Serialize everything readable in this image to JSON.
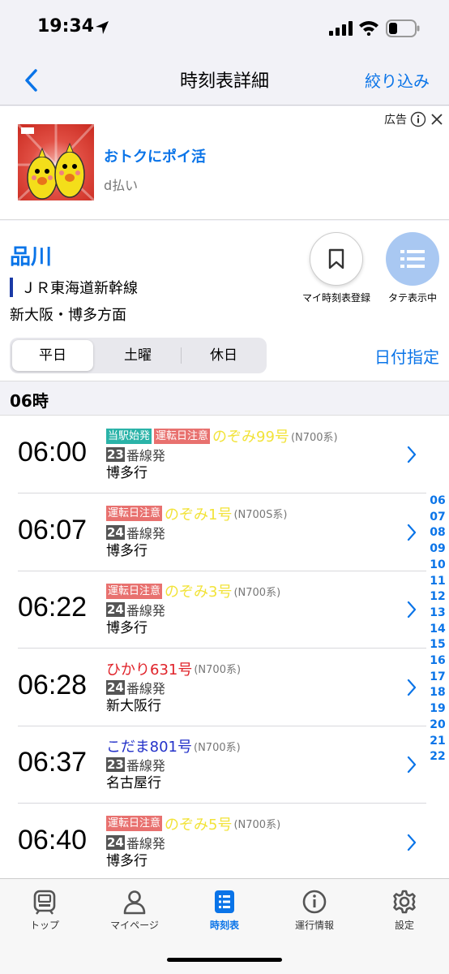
{
  "status_bar": {
    "time": "19:34"
  },
  "nav": {
    "title": "時刻表詳細",
    "filter_label": "絞り込み"
  },
  "ad": {
    "label": "広告",
    "title": "おトクにポイ活",
    "sponsor": "d払い"
  },
  "station": {
    "name": "品川",
    "line": "ＪＲ東海道新幹線",
    "line_color": "#1a3aa6",
    "direction": "新大阪・博多方面",
    "my_timetable_label": "マイ時刻表登録",
    "vertical_view_label": "タテ表示中"
  },
  "day_tabs": {
    "items": [
      "平日",
      "土曜",
      "休日"
    ],
    "selected": "平日",
    "date_label": "日付指定"
  },
  "hour_header": "06時",
  "departures": [
    {
      "time": "06:00",
      "badges": [
        "当駅始発",
        "運転日注意"
      ],
      "train": "のぞみ99号",
      "train_color": "yellow",
      "car": "(N700系)",
      "platform": "23",
      "platform_suffix": "番線発",
      "destination": "博多行"
    },
    {
      "time": "06:07",
      "badges": [
        "運転日注意"
      ],
      "train": "のぞみ1号",
      "train_color": "yellow",
      "car": "(N700S系)",
      "platform": "24",
      "platform_suffix": "番線発",
      "destination": "博多行"
    },
    {
      "time": "06:22",
      "badges": [
        "運転日注意"
      ],
      "train": "のぞみ3号",
      "train_color": "yellow",
      "car": "(N700系)",
      "platform": "24",
      "platform_suffix": "番線発",
      "destination": "博多行"
    },
    {
      "time": "06:28",
      "badges": [],
      "train": "ひかり631号",
      "train_color": "red",
      "car": "(N700系)",
      "platform": "24",
      "platform_suffix": "番線発",
      "destination": "新大阪行"
    },
    {
      "time": "06:37",
      "badges": [],
      "train": "こだま801号",
      "train_color": "blue",
      "car": "(N700系)",
      "platform": "23",
      "platform_suffix": "番線発",
      "destination": "名古屋行"
    },
    {
      "time": "06:40",
      "badges": [
        "運転日注意"
      ],
      "train": "のぞみ5号",
      "train_color": "yellow",
      "car": "(N700系)",
      "platform": "24",
      "platform_suffix": "番線発",
      "destination": "博多行"
    }
  ],
  "hour_index": [
    "06",
    "07",
    "08",
    "09",
    "10",
    "11",
    "12",
    "13",
    "14",
    "15",
    "16",
    "17",
    "18",
    "19",
    "20",
    "21",
    "22"
  ],
  "tab_bar": {
    "items": [
      {
        "label": "トップ",
        "icon": "train-icon"
      },
      {
        "label": "マイページ",
        "icon": "person-icon"
      },
      {
        "label": "時刻表",
        "icon": "timetable-icon"
      },
      {
        "label": "運行情報",
        "icon": "info-icon"
      },
      {
        "label": "設定",
        "icon": "gear-icon"
      }
    ],
    "active": "時刻表"
  },
  "colors": {
    "accent": "#0a74e8",
    "badge_teal": "#2ab3a8",
    "badge_red": "#e8716f",
    "nozomi": "#f2e33a",
    "hikari": "#e0232a",
    "kodama": "#2432c9"
  }
}
